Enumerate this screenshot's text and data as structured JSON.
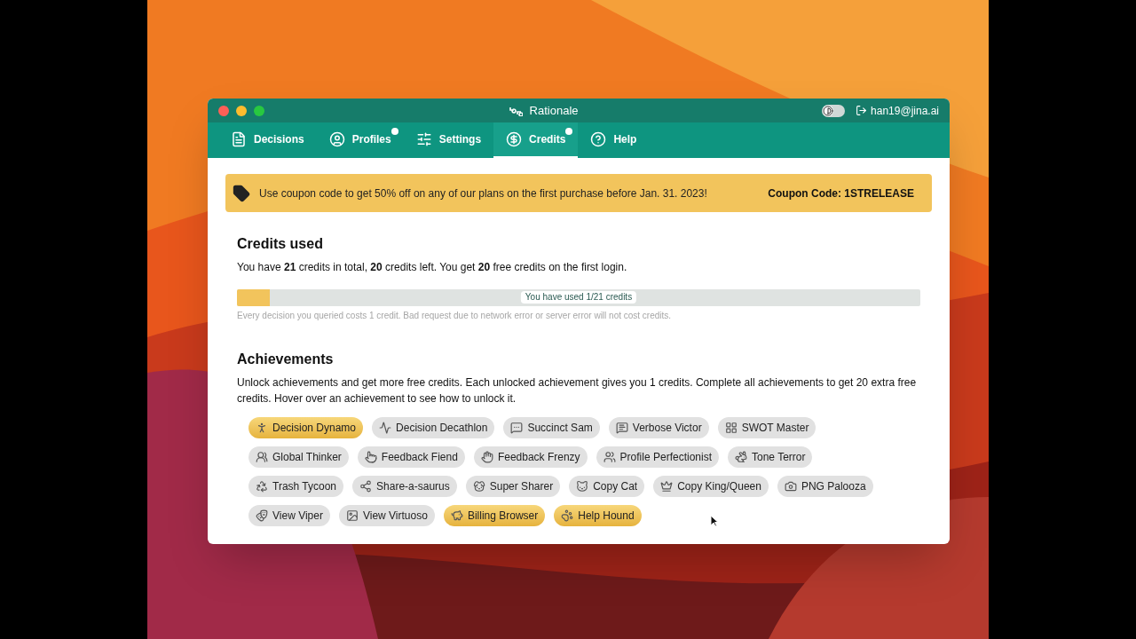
{
  "window": {
    "title": "Rationale",
    "user": "han19@jina.ai",
    "dark_mode": false
  },
  "tabs": [
    {
      "label": "Decisions",
      "selected": false,
      "dot": false
    },
    {
      "label": "Profiles",
      "selected": false,
      "dot": true
    },
    {
      "label": "Settings",
      "selected": false,
      "dot": false
    },
    {
      "label": "Credits",
      "selected": true,
      "dot": true
    },
    {
      "label": "Help",
      "selected": false,
      "dot": false
    }
  ],
  "banner": {
    "text": "Use coupon code to get 50% off on any of our plans on the first purchase before Jan. 31. 2023!",
    "code": "Coupon Code: 1STRELEASE"
  },
  "credits": {
    "title": "Credits used",
    "summary": "You have **21** credits in total, **20** credits left. You get **20** free credits on the first login.",
    "level": 0.048,
    "reading": "You have used 1/21 credits",
    "note": "Every decision you queried costs 1 credit. Bad request due to network error or server error will not cost credits."
  },
  "achievements": {
    "title": "Achievements",
    "description": "Unlock achievements and get more free credits. Each unlocked achievement gives you 1 credits. Complete all achievements to get 20 extra free credits. Hover over an achievement to see how to unlock it.",
    "rows": [
      [
        {
          "label": "Decision Dynamo",
          "unlocked": true
        },
        {
          "label": "Decision Decathlon",
          "unlocked": false
        },
        {
          "label": "Succinct Sam",
          "unlocked": false
        },
        {
          "label": "Verbose Victor",
          "unlocked": false
        },
        {
          "label": "SWOT Master",
          "unlocked": false
        }
      ],
      [
        {
          "label": "Global Thinker",
          "unlocked": false
        },
        {
          "label": "Feedback Fiend",
          "unlocked": false
        },
        {
          "label": "Feedback Frenzy",
          "unlocked": false
        },
        {
          "label": "Profile Perfectionist",
          "unlocked": false
        },
        {
          "label": "Tone Terror",
          "unlocked": false
        }
      ],
      [
        {
          "label": "Trash Tycoon",
          "unlocked": false
        },
        {
          "label": "Share-a-saurus",
          "unlocked": false
        },
        {
          "label": "Super Sharer",
          "unlocked": false
        },
        {
          "label": "Copy Cat",
          "unlocked": false
        },
        {
          "label": "Copy King/Queen",
          "unlocked": false
        },
        {
          "label": "PNG Palooza",
          "unlocked": false
        }
      ],
      [
        {
          "label": "View Viper",
          "unlocked": false
        },
        {
          "label": "View Virtuoso",
          "unlocked": false
        },
        {
          "label": "Billing Browser",
          "unlocked": true
        },
        {
          "label": "Help Hound",
          "unlocked": true
        }
      ]
    ]
  }
}
